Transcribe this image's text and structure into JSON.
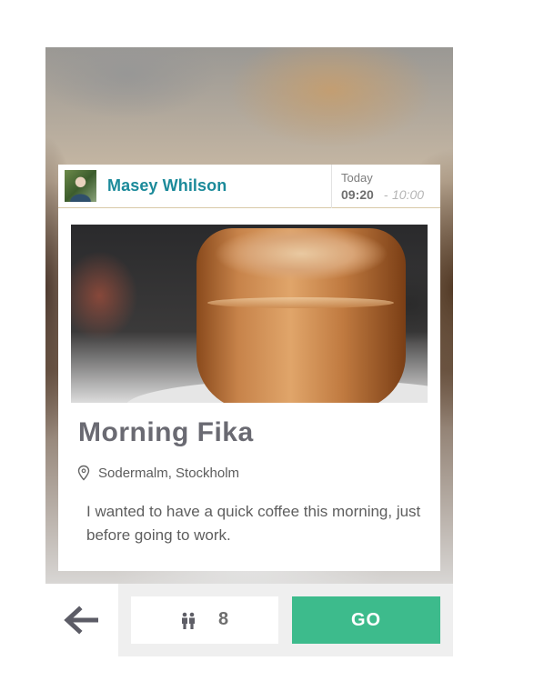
{
  "event": {
    "host": {
      "name": "Masey Whilson",
      "avatar_icon": "person-photo"
    },
    "schedule": {
      "day": "Today",
      "start": "09:20",
      "separator": "-",
      "end": "10:00"
    },
    "image": "coffee-latte-glass-photo",
    "title": "Morning Fika",
    "location": "Sodermalm, Stockholm",
    "description": "I wanted to have a quick coffee this morning, just before going to work."
  },
  "actions": {
    "back_icon": "arrow-left-icon",
    "attendees_icon": "people-icon",
    "attendees_count": "8",
    "go_label": "GO"
  },
  "colors": {
    "accent_teal": "#1b8a9a",
    "go_green": "#3dbb8c",
    "title_gray": "#6a6a72"
  }
}
